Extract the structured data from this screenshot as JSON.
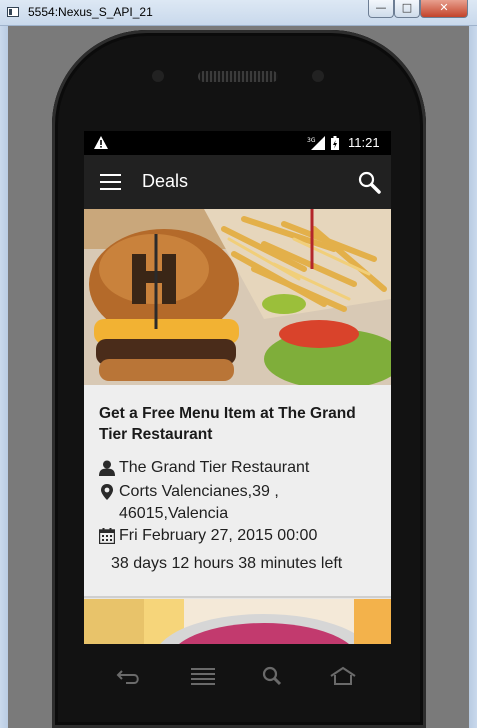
{
  "window": {
    "title": "5554:Nexus_S_API_21",
    "minimize_label": "—",
    "maximize_label": "□",
    "close_label": "✕"
  },
  "status_bar": {
    "time": "11:21",
    "icons": [
      "warning-icon",
      "signal-3g-icon",
      "battery-charging-icon"
    ]
  },
  "app_bar": {
    "title": "Deals",
    "left_icon": "menu-icon",
    "right_icon": "search-icon"
  },
  "deals": [
    {
      "title": "Get a Free Menu Item at The Grand Tier Restaurant",
      "business": "The Grand Tier Restaurant",
      "address": "Corts Valencianes,39 ,\n46015,Valencia",
      "address_line1": "Corts Valencianes,39 ,",
      "address_line2": "46015,Valencia",
      "date": "Fri February 27, 2015 00:00",
      "time_left": "38 days 12 hours 38 minutes left",
      "image": "burger-and-fries-photo"
    }
  ],
  "phone_keys": [
    "back-icon",
    "menu-key-icon",
    "search-key-icon",
    "home-icon"
  ],
  "colors": {
    "app_bar": "#212121",
    "card_background": "#eeeeee",
    "emulator_background": "#7a7a7a"
  }
}
